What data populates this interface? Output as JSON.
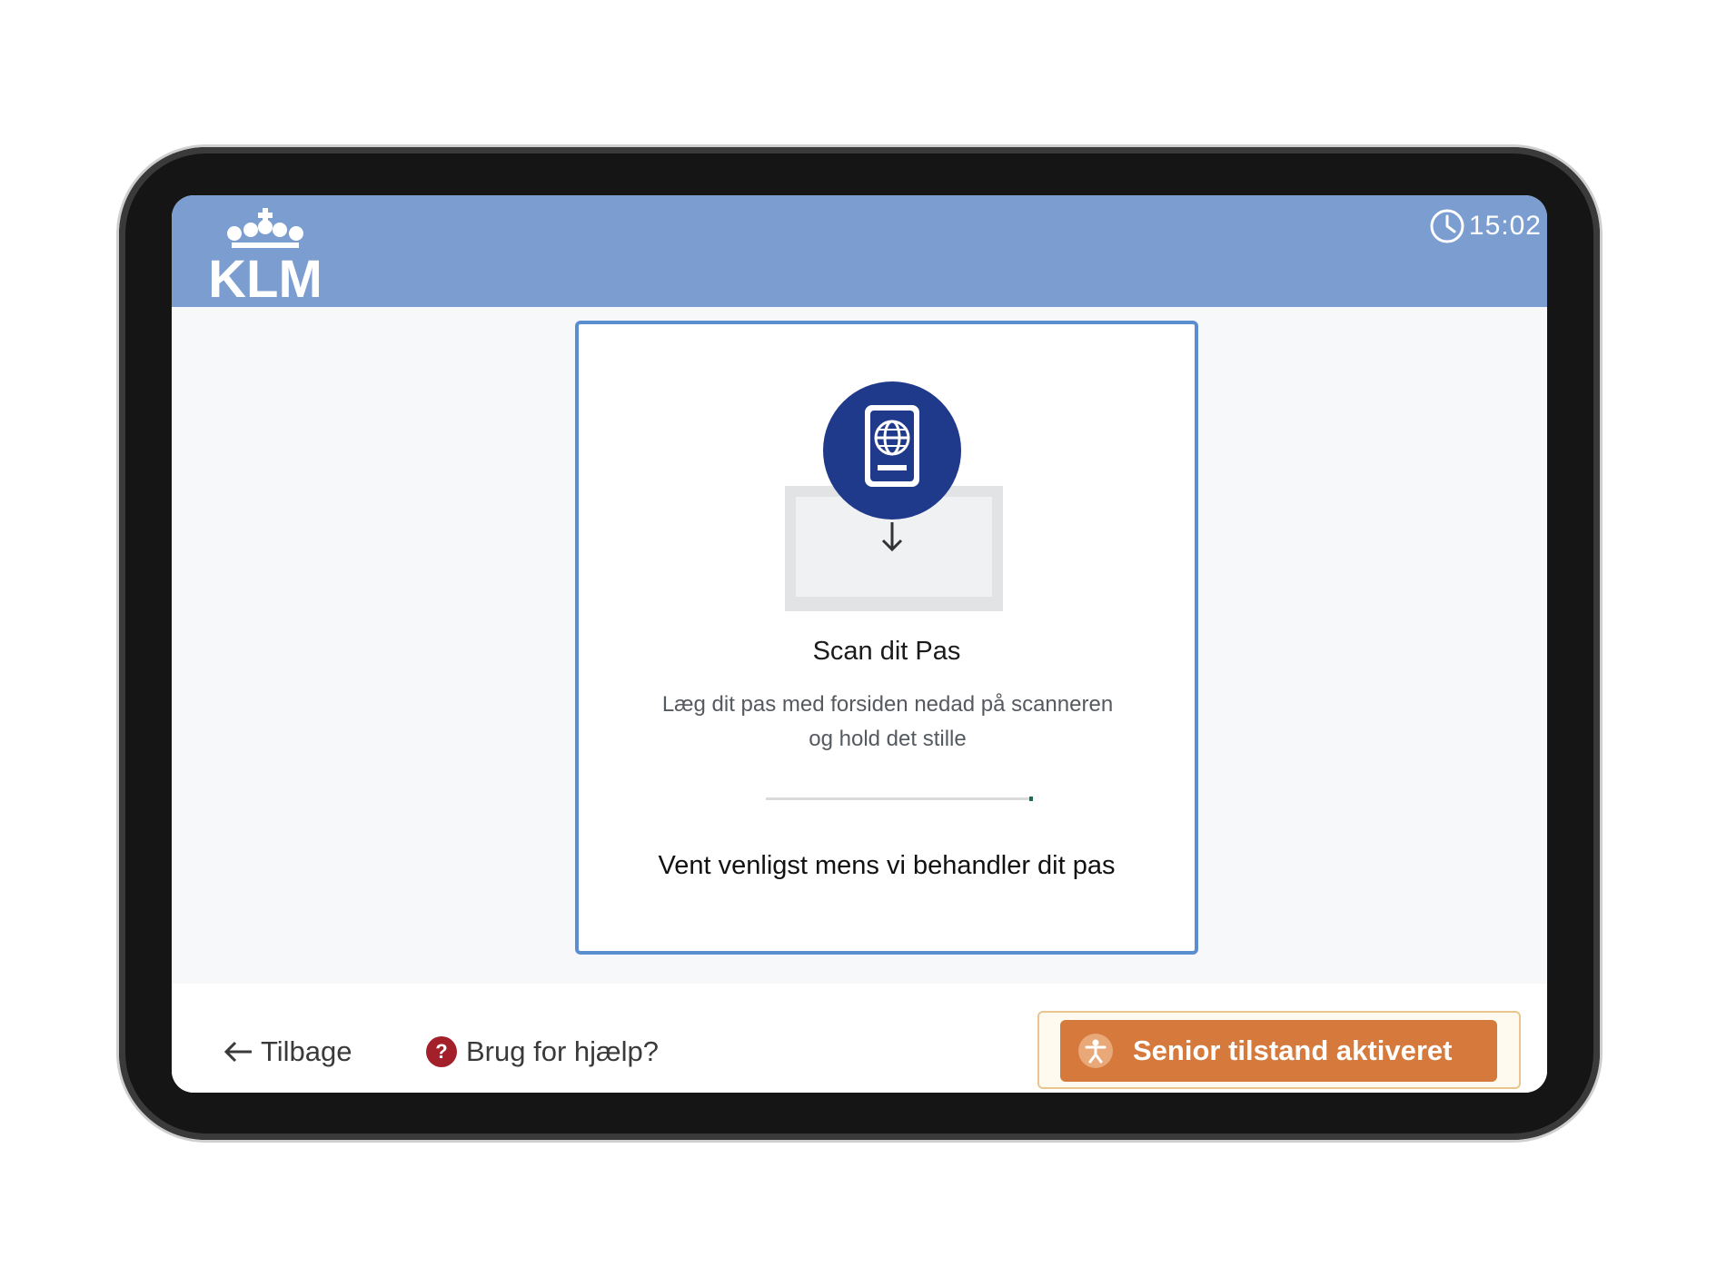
{
  "brand": {
    "logo_text": "KLM"
  },
  "header": {
    "time": "15:02",
    "icon": "clock-icon"
  },
  "card": {
    "title": "Scan dit Pas",
    "description": "Læg dit pas med forsiden nedad på scanneren og hold det stille",
    "progress_percent": 99,
    "status": "Vent venligst mens vi behandler dit pas",
    "icons": [
      "passport-icon",
      "arrow-down-icon"
    ]
  },
  "footer": {
    "back_label": "Tilbage",
    "help_label": "Brug for hjælp?",
    "help_glyph": "?",
    "senior_label": "Senior tilstand aktiveret"
  },
  "colors": {
    "header": "#7b9dd0",
    "card_border": "#5b8ed0",
    "badge": "#1f3a8a",
    "help": "#a3202a",
    "senior": "#d57a3c"
  }
}
